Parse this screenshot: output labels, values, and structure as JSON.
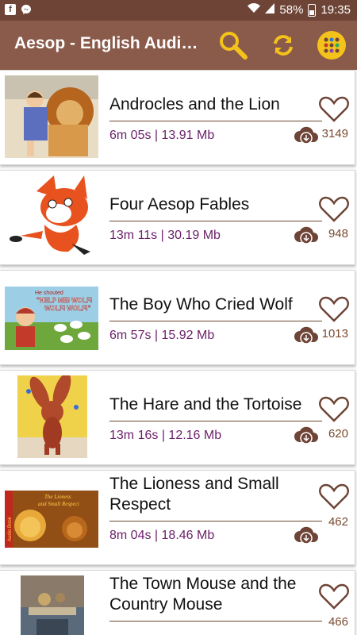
{
  "status_bar": {
    "battery": "58%",
    "time": "19:35",
    "left_icons": [
      "facebook-icon",
      "messenger-icon"
    ],
    "right_icons": [
      "wifi-icon",
      "signal-icon",
      "battery-icon"
    ]
  },
  "app_bar": {
    "title": "Aesop - English Audio…",
    "actions": [
      "search-icon",
      "sync-icon",
      "menu-grid-icon"
    ]
  },
  "colors": {
    "status_bar": "#6e4436",
    "app_bar": "#8a5a4a",
    "accent_yellow": "#f3c21b",
    "meta_text": "#6a1f6a",
    "icon_brown": "#6e4436"
  },
  "stories": [
    {
      "title": "Androcles and the Lion",
      "meta": "6m 05s | 13.91 Mb",
      "count": "3149"
    },
    {
      "title": "Four Aesop Fables",
      "meta": "13m 11s | 30.19 Mb",
      "count": "948"
    },
    {
      "title": "The Boy Who Cried Wolf",
      "meta": "6m 57s | 15.92 Mb",
      "count": "1013"
    },
    {
      "title": "The Hare and the Tortoise",
      "meta": "13m 16s | 12.16 Mb",
      "count": "620"
    },
    {
      "title": "The Lioness and Small Respect",
      "meta": "8m 04s | 18.46 Mb",
      "count": "462"
    },
    {
      "title": "The Town Mouse and the Country Mouse",
      "meta": "",
      "count": "466"
    }
  ],
  "thumb_text": {
    "boy_wolf_line1": "He shouted",
    "boy_wolf_line2": "\"HELP ME! WOLF!",
    "boy_wolf_line3": "WOLF! WOLF!\"",
    "lioness_banner": "Audio Book",
    "lioness_line1": "The Lioness",
    "lioness_line2": "and Small Respect"
  }
}
